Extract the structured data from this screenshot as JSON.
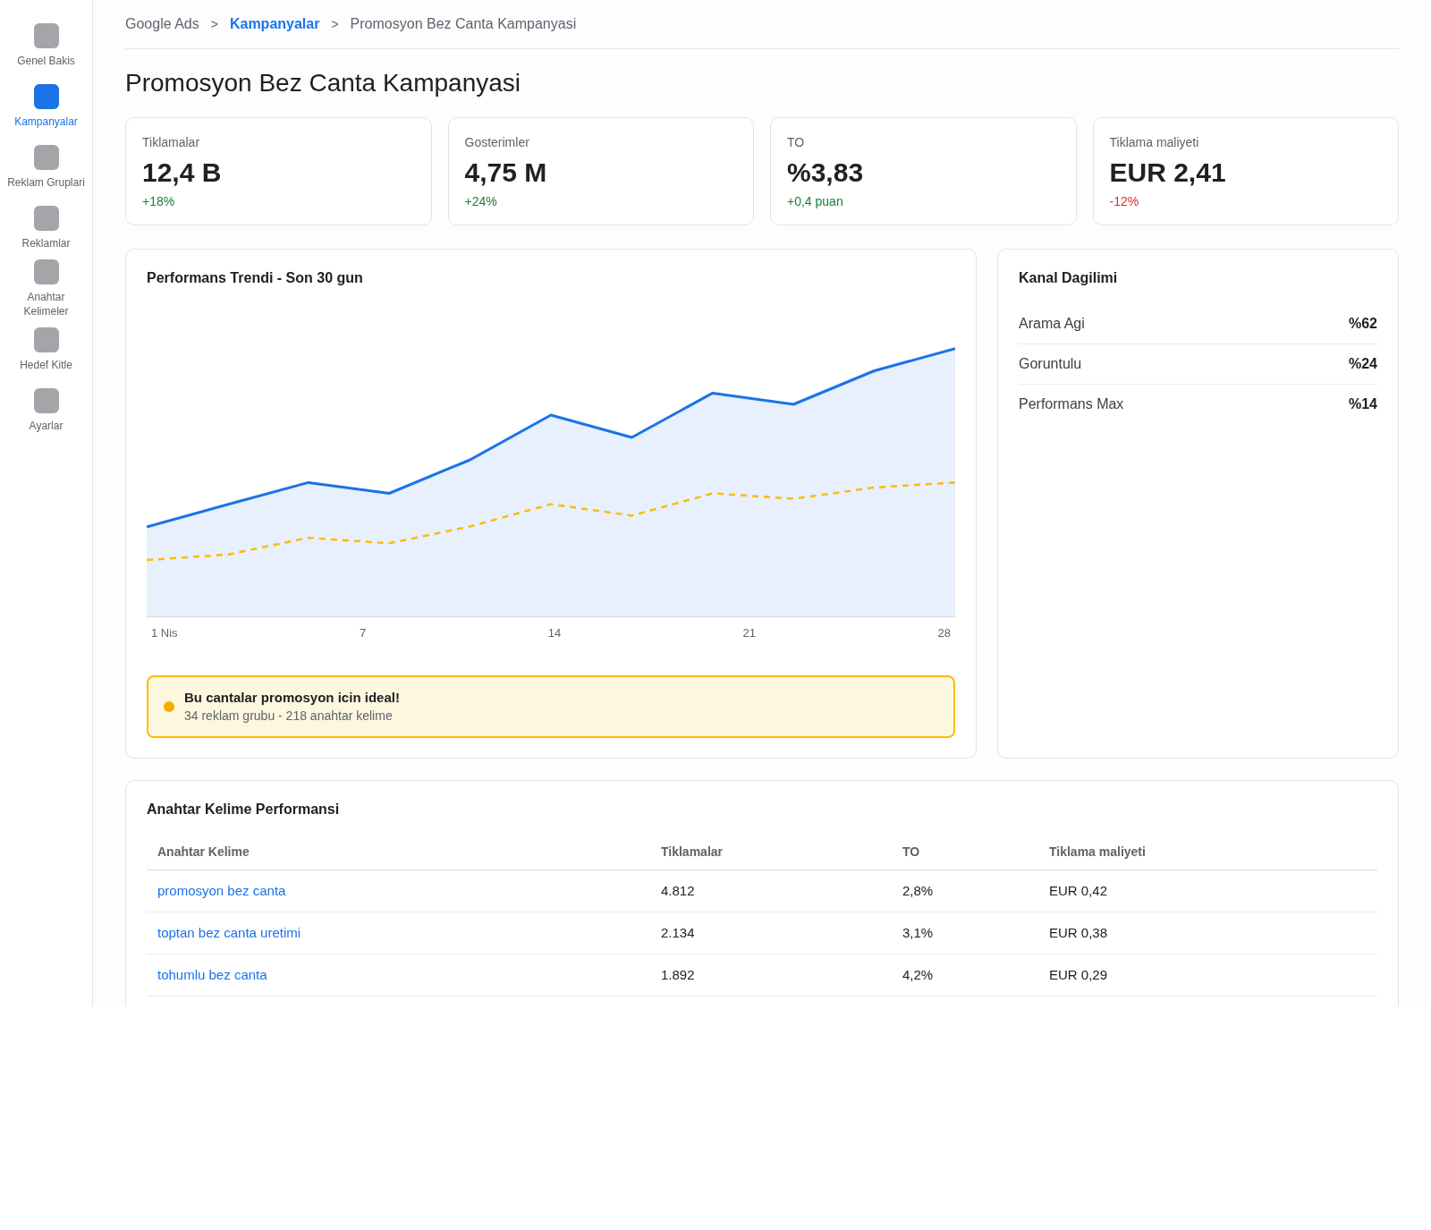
{
  "sidebar": {
    "items": [
      {
        "label": "Genel Bakis",
        "selected": false
      },
      {
        "label": "Kampanyalar",
        "selected": true
      },
      {
        "label": "Reklam Gruplari",
        "selected": false
      },
      {
        "label": "Reklamlar",
        "selected": false
      },
      {
        "label": "Anahtar Kelimeler",
        "selected": false
      },
      {
        "label": "Hedef Kitle",
        "selected": false
      },
      {
        "label": "Ayarlar",
        "selected": false
      }
    ]
  },
  "breadcrumb": [
    {
      "label": "Google Ads",
      "kind": "text"
    },
    {
      "separator": ">",
      "label": "Kampanyalar",
      "kind": "link"
    },
    {
      "separator": ">",
      "label": "Promosyon Bez Canta Kampanyasi",
      "kind": "text"
    }
  ],
  "page_title": "Promosyon Bez Canta Kampanyasi",
  "stats": [
    {
      "label": "Tiklamalar",
      "value": "12,4 B",
      "change": "+18%",
      "color": "#188038"
    },
    {
      "label": "Gosterimler",
      "value": "4,75 M",
      "change": "+24%",
      "color": "#188038"
    },
    {
      "label": "TO",
      "value": "%3,83",
      "change": "+0,4 puan",
      "color": "#188038"
    },
    {
      "label": "Tiklama maliyeti",
      "value": "EUR 2,41",
      "change": "-12%",
      "color": "#d93025"
    }
  ],
  "trend_chart": {
    "title": "Performans Trendi - Son 30 gun",
    "x_labels": [
      "1 Nis",
      "7",
      "14",
      "21",
      "28"
    ],
    "notice": {
      "title": "Bu cantalar promosyon icin ideal!",
      "text": "34 reklam grubu - 218 anahtar kelime"
    }
  },
  "channels": {
    "title": "Kanal Dagilimi",
    "rows": [
      {
        "name": "Arama Agi",
        "share": "%62"
      },
      {
        "name": "Goruntulu",
        "share": "%24"
      },
      {
        "name": "Performans Max",
        "share": "%14"
      }
    ]
  },
  "keywords": {
    "title": "Anahtar Kelime Performansi",
    "columns": [
      "Anahtar Kelime",
      "Tiklamalar",
      "TO",
      "Tiklama maliyeti"
    ],
    "rows": [
      {
        "keyword": "promosyon bez canta",
        "clicks": "4.812",
        "ctr": "2,8%",
        "cpc": "EUR 0,42"
      },
      {
        "keyword": "toptan bez canta uretimi",
        "clicks": "2.134",
        "ctr": "3,1%",
        "cpc": "EUR 0,38"
      },
      {
        "keyword": "tohumlu bez canta",
        "clicks": "1.892",
        "ctr": "4,2%",
        "cpc": "EUR 0,29"
      }
    ]
  }
}
